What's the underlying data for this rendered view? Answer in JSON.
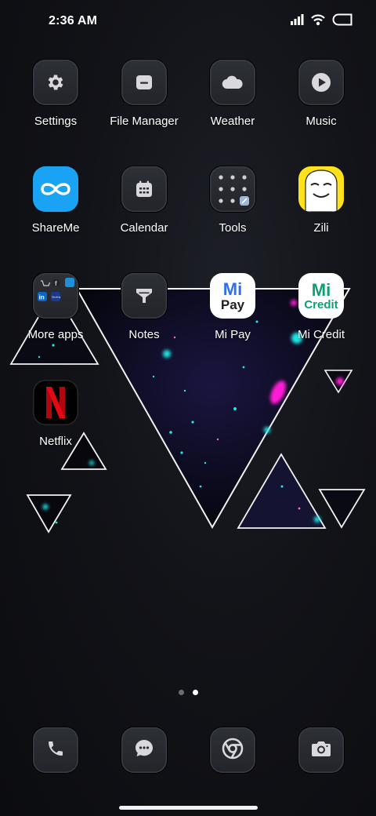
{
  "status_bar": {
    "time": "2:36 AM",
    "icons": [
      "signal-icon",
      "hotspot-icon",
      "battery-icon"
    ]
  },
  "apps": [
    {
      "label": "Settings",
      "icon": "gear-icon"
    },
    {
      "label": "File Manager",
      "icon": "folder-icon"
    },
    {
      "label": "Weather",
      "icon": "cloud-icon"
    },
    {
      "label": "Music",
      "icon": "play-icon"
    },
    {
      "label": "ShareMe",
      "icon": "infinity-icon"
    },
    {
      "label": "Calendar",
      "icon": "calendar-icon"
    },
    {
      "label": "Tools",
      "icon": "tools-folder-icon"
    },
    {
      "label": "Zili",
      "icon": "zili-face-icon"
    },
    {
      "label": "More apps",
      "icon": "apps-folder-icon"
    },
    {
      "label": "Notes",
      "icon": "funnel-icon"
    },
    {
      "label": "Mi Pay",
      "icon": "mi-pay-logo",
      "logo_text": [
        "Mi",
        "Pay"
      ]
    },
    {
      "label": "Mi Credit",
      "icon": "mi-credit-logo",
      "logo_text": [
        "Mi",
        "Credit"
      ]
    },
    {
      "label": "Netflix",
      "icon": "netflix-n-icon"
    }
  ],
  "more_apps_folder": {
    "mini_icons": [
      "cart-icon",
      "facebook-icon",
      "amazon-prime-icon",
      "linkedin-icon",
      "booking-icon"
    ],
    "logo_text": [
      "in",
      "Booking"
    ]
  },
  "page_indicator": {
    "pages": 2,
    "current": 2
  },
  "dock": [
    {
      "icon": "phone-icon"
    },
    {
      "icon": "messages-icon"
    },
    {
      "icon": "chrome-icon"
    },
    {
      "icon": "camera-icon"
    }
  ],
  "colors": {
    "accent_cyan": "#23e6e6",
    "accent_magenta": "#ff1fd6",
    "shareme_blue": "#1aa3f4",
    "zili_yellow": "#ffe21a",
    "netflix_red": "#e50914",
    "mi_blue": "#2f6ff2",
    "mi_green": "#0f9f71"
  }
}
